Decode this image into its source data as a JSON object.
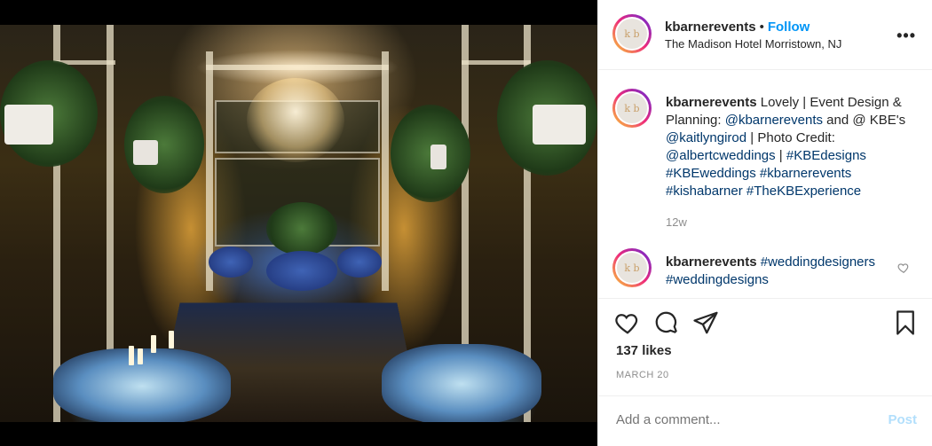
{
  "post": {
    "username": "kbarnerevents",
    "follow_label": "Follow",
    "separator": "•",
    "location": "The Madison Hotel Morristown, NJ",
    "more_label": "•••",
    "avatar_text": "k b",
    "photo_alt": "Wedding reception venue with chandeliers and blue lit tables"
  },
  "caption": {
    "username": "kbarnerevents",
    "text_start": "Lovely | Event Design & Planning: ",
    "mention1": "@kbarnerevents",
    "text_mid": " and @ KBE's ",
    "mention2": "@kaitlyngirod",
    "text_mid2": " | Photo Credit: ",
    "mention3": "@albertcweddings",
    "sep": " | ",
    "tag1": "#KBEdesigns",
    "tag2": "#KBEweddings",
    "tag3": "#kbarnerevents",
    "tag4": "#kishabarner",
    "tag5": "#TheKBExperience",
    "time": "12w"
  },
  "comment": {
    "username": "kbarnerevents",
    "tag1": "#weddingdesigners",
    "tag2": "#weddingdesigns"
  },
  "actions": {
    "likes": "137 likes",
    "date": "MARCH 20"
  },
  "add_comment": {
    "placeholder": "Add a comment...",
    "post_label": "Post"
  },
  "colors": {
    "link": "#0095f6",
    "hashtag": "#00376b",
    "muted": "#8e8e8e"
  }
}
